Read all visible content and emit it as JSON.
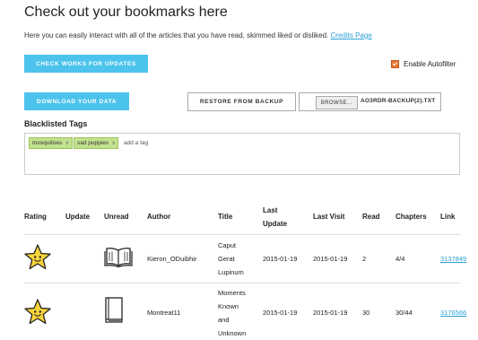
{
  "page": {
    "title": "Check out your bookmarks here",
    "intro_text": "Here you can easily interact with all of the articles that you have read, skimmed liked or disliked.",
    "credits_link": "Credits Page"
  },
  "toolbar": {
    "check_updates_label": "CHECK WORKS FOR UPDATES",
    "download_label": "DOWNLOAD YOUR DATA",
    "restore_label": "RESTORE FROM BACKUP",
    "browse_label": "BROWSE...",
    "file_name": "AO3RDR-BACKUP(2).TXT",
    "autofilter_label": "Enable Autofilter",
    "autofilter_checked": true
  },
  "blacklist": {
    "label": "Blacklisted Tags",
    "tags": [
      {
        "text": "mosquitoes",
        "remove": "x"
      },
      {
        "text": "sad puppies",
        "remove": "x"
      }
    ],
    "placeholder": "add a tag"
  },
  "table": {
    "headers": {
      "rating": "Rating",
      "update": "Update",
      "unread": "Unread",
      "author": "Author",
      "title": "Title",
      "last_update_1": "Last",
      "last_update_2": "Update",
      "last_visit": "Last Visit",
      "read": "Read",
      "chapters": "Chapters",
      "link": "Link"
    },
    "rows": [
      {
        "rating_icon": "star-smile-icon",
        "unread_icon": "open-book-icon",
        "author": "Kieron_ODuibhir",
        "title_lines": [
          "Caput",
          "Gerat",
          "Lupinum"
        ],
        "last_update": "2015-01-19",
        "last_visit": "2015-01-19",
        "read": "2",
        "chapters": "4/4",
        "link": "3137849"
      },
      {
        "rating_icon": "star-smile-icon",
        "unread_icon": "closed-book-icon",
        "author": "Montreat11",
        "title_lines": [
          "Moments",
          "Known",
          "and",
          "Unknown"
        ],
        "last_update": "2015-01-19",
        "last_visit": "2015-01-19",
        "read": "30",
        "chapters": "30/44",
        "link": "3176566"
      }
    ]
  },
  "colors": {
    "accent_blue": "#4cc3ec",
    "tag_green": "#c3e28f",
    "checkbox_orange": "#e8752f",
    "link_blue": "#2a9fd6",
    "star_yellow": "#f7d43a"
  }
}
